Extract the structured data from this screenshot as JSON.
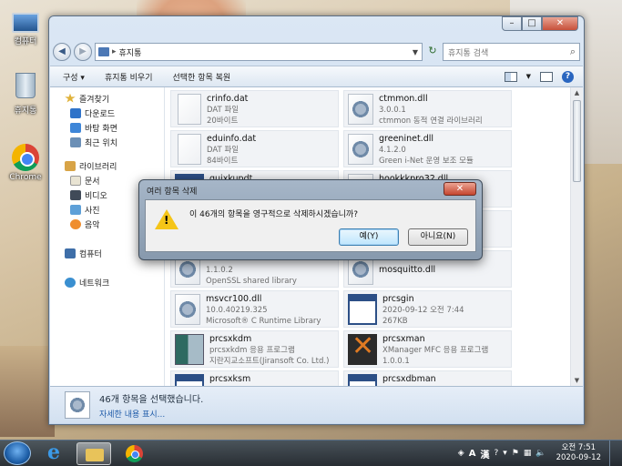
{
  "desktop": {
    "icons": [
      {
        "label": "컴퓨터",
        "icon": "computer-icon"
      },
      {
        "label": "휴지통",
        "icon": "recycle-bin-icon"
      },
      {
        "label": "Chrome",
        "icon": "chrome-icon"
      }
    ]
  },
  "explorer": {
    "address": "휴지통",
    "search_placeholder": "휴지통 검색",
    "toolbar": {
      "organize": "구성 ▾",
      "empty_bin": "휴지통 비우기",
      "restore_selected": "선택한 항목 복원"
    },
    "nav": {
      "favorites": "즐겨찾기",
      "downloads": "다운로드",
      "desktop": "바탕 화면",
      "recent": "최근 위치",
      "libraries": "라이브러리",
      "documents": "문서",
      "videos": "비디오",
      "pictures": "사진",
      "music": "음악",
      "computer": "컴퓨터",
      "network": "네트워크"
    },
    "files": [
      {
        "name": "crinfo.dat",
        "l2": "DAT 파일",
        "l3": "20바이트",
        "icon": "file-icon"
      },
      {
        "name": "ctmmon.dll",
        "l2": "3.0.0.1",
        "l3": "ctmmon 동적 연결 라이브러리",
        "icon": "dll-gear-icon"
      },
      {
        "name": "eduinfo.dat",
        "l2": "DAT 파일",
        "l3": "84바이트",
        "icon": "file-icon"
      },
      {
        "name": "greeninet.dll",
        "l2": "4.1.2.0",
        "l3": "Green i-Net 운영 보조 모듈",
        "icon": "dll-gear-icon"
      },
      {
        "name": "quixkupdt",
        "l2": "",
        "l3": "",
        "icon": "app-icon"
      },
      {
        "name": "hookkkpro32.dll",
        "l2": "",
        "l3": "",
        "icon": "dll-gear-icon"
      },
      {
        "name": "",
        "l2": "1.1.0.2",
        "l3": "OpenSSL shared library",
        "icon": "dll-gear-icon"
      },
      {
        "name": "mosquitto.dll",
        "l2": "",
        "l3": "",
        "icon": "dll-gear-icon"
      },
      {
        "name": "msvcr100.dll",
        "l2": "10.0.40219.325",
        "l3": "Microsoft® C Runtime Library",
        "icon": "dll-gear-icon"
      },
      {
        "name": "prcsgin",
        "l2": "2020-09-12 오전 7:44",
        "l3": "267KB",
        "icon": "app-window-icon"
      },
      {
        "name": "prcsxkdm",
        "l2": "prcsxkdm 응용 프로그램",
        "l3": "지란지교소프트(Jiransoft Co. Ltd.)",
        "icon": "prcs-app-icon"
      },
      {
        "name": "prcsxman",
        "l2": "XManager MFC 응용 프로그램",
        "l3": "1.0.0.1",
        "icon": "xmanager-icon"
      },
      {
        "name": "prcsxksm",
        "l2": "",
        "l3": "",
        "icon": "app-window-icon"
      },
      {
        "name": "prcsxdbman",
        "l2": "",
        "l3": "",
        "icon": "app-window-icon"
      }
    ],
    "details": {
      "count_text": "46개 항목을 선택했습니다.",
      "more_link": "자세한 내용 표시..."
    }
  },
  "dialog": {
    "title": "여러 항목 삭제",
    "message": "이 46개의 항목을 영구적으로 삭제하시겠습니까?",
    "yes": "예(Y)",
    "no": "아니요(N)"
  },
  "taskbar": {
    "ime_mode": "A",
    "ime_hanja": "漢",
    "time": "오전 7:51",
    "date": "2020-09-12"
  }
}
